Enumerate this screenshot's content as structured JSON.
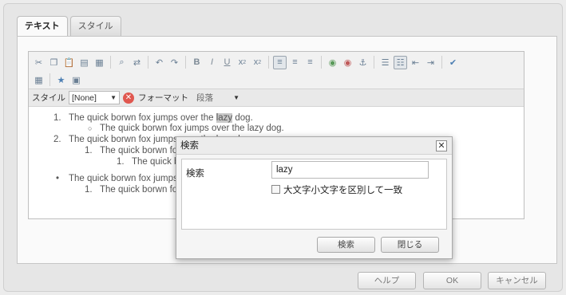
{
  "tabs": [
    "テキスト",
    "スタイル"
  ],
  "toolbar_icons": [
    "cut-icon",
    "copy-icon",
    "paste-icon",
    "paste-text-icon",
    "paste-word-icon",
    "find-icon",
    "replace-icon",
    "undo-icon",
    "redo-icon",
    "bold-icon",
    "italic-icon",
    "underline-icon",
    "subscript-icon",
    "superscript-icon",
    "align-left-icon",
    "align-center-icon",
    "align-right-icon",
    "link-icon",
    "unlink-icon",
    "anchor-icon",
    "bulleted-list-icon",
    "numbered-list-icon",
    "outdent-icon",
    "indent-icon",
    "spellcheck-icon",
    "table-icon",
    "special-char-icon",
    "image-icon"
  ],
  "style_bar": {
    "style_label": "スタイル",
    "style_value": "[None]",
    "format_label": "フォーマット",
    "format_value": "段落"
  },
  "content": {
    "l1": "1.",
    "t1_pre": "The quick borwn fox jumps over the ",
    "t1_hl": "lazy",
    "t1_post": " dog.",
    "l2": "○",
    "t2": "The quick borwn fox jumps over the lazy dog.",
    "l3": "2.",
    "t3": "The quick borwn fox jumps over the lazy dog.",
    "l4": "1.",
    "t4": "The quick borwn fox jumps over the lazy dog.",
    "l5": "1.",
    "t5": "The quick borwn fox jumps over the lazy dog.",
    "l6": "•",
    "t6": "The quick borwn fox jumps over the lazy dog.",
    "l7": "1.",
    "t7": "The quick borwn fox jumps over the lazy dog."
  },
  "bottom_buttons": {
    "help": "ヘルプ",
    "ok": "OK",
    "cancel": "キャンセル"
  },
  "dialog": {
    "title": "検索",
    "close": "✕",
    "search_label": "検索",
    "search_value": "lazy",
    "match_case_label": "大文字小文字を区別して一致",
    "find_button": "検索",
    "close_button": "閉じる"
  }
}
